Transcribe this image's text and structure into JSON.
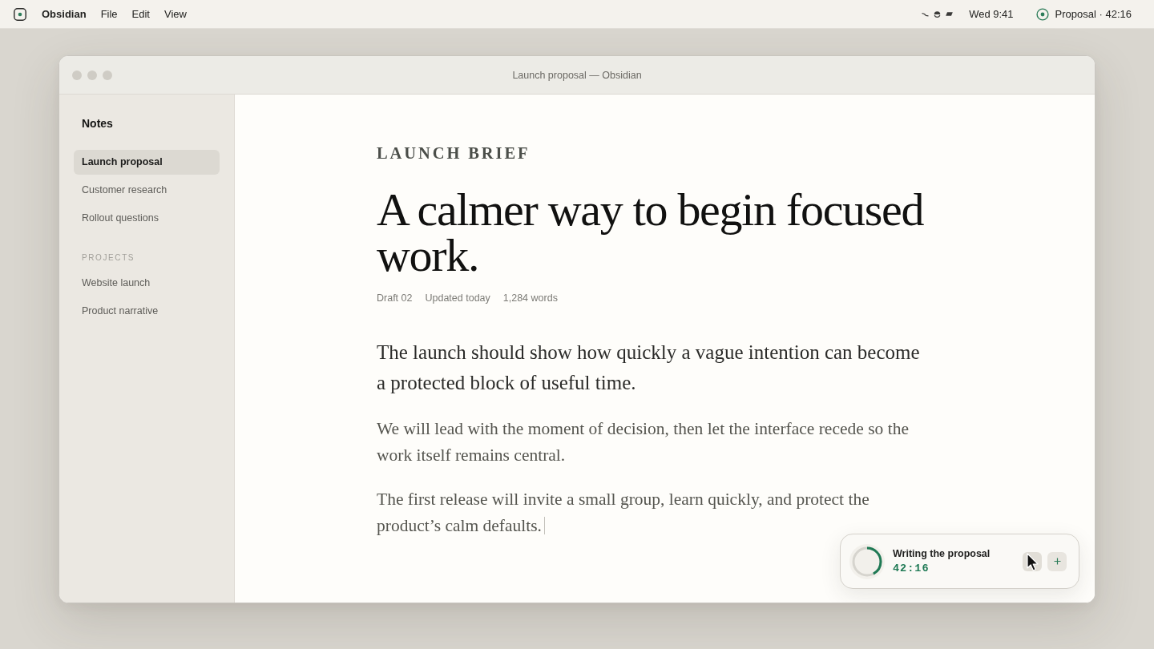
{
  "menu_bar": {
    "app_name": "Obsidian",
    "menus": [
      "File",
      "Edit",
      "View"
    ],
    "clock": "Wed 9:41",
    "timer_status": "Proposal · 42:16"
  },
  "window": {
    "title": "Launch proposal — Obsidian"
  },
  "sidebar": {
    "title": "Notes",
    "items": [
      {
        "label": "Launch proposal",
        "selected": true
      },
      {
        "label": "Customer research",
        "selected": false
      },
      {
        "label": "Rollout questions",
        "selected": false
      }
    ],
    "sections": [
      {
        "heading": "PROJECTS",
        "items": [
          {
            "label": "Website launch",
            "selected": false
          },
          {
            "label": "Product narrative",
            "selected": false
          }
        ]
      }
    ]
  },
  "document": {
    "eyebrow": "LAUNCH BRIEF",
    "title": "A calmer way to begin focused work.",
    "meta": [
      "Draft 02",
      "Updated today",
      "1,284 words"
    ],
    "paragraphs": [
      {
        "kind": "lead",
        "caret": false,
        "text": "The launch should show how quickly a vague intention can become a protected block of useful time."
      },
      {
        "kind": "body",
        "caret": false,
        "text": "We will lead with the moment of decision, then let the interface recede so the work itself remains central."
      },
      {
        "kind": "body",
        "caret": true,
        "text": "The first release will invite a small group, learn quickly, and protect the product’s calm defaults."
      }
    ]
  },
  "timer_widget": {
    "label": "Writing the proposal",
    "time": "42:16",
    "level": 0.42,
    "buttons": [
      {
        "kind": "blank",
        "hovered": true
      },
      {
        "kind": "add",
        "hovered": false
      }
    ]
  }
}
